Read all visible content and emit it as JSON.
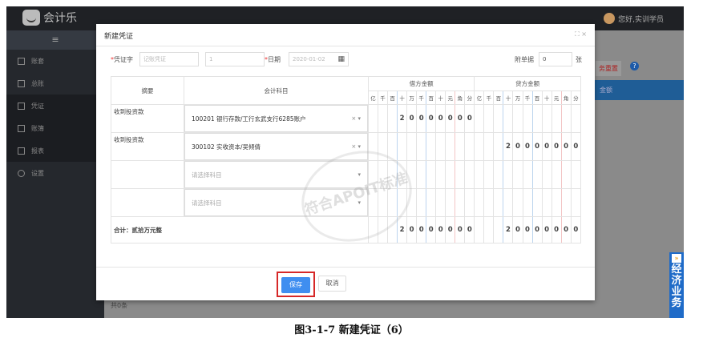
{
  "app": {
    "logo_text": "会计乐",
    "user": "您好,实训学员"
  },
  "sidebar": {
    "toggle": "≡",
    "items": [
      "账套",
      "总账",
      "凭证",
      "账簿",
      "报表",
      "设置"
    ]
  },
  "background": {
    "reset": "务重置",
    "help": "?",
    "bar": "金额",
    "footer": "共0条"
  },
  "float": {
    "arrow": "»",
    "label": "经济业务"
  },
  "modal": {
    "title": "新建凭证",
    "ctrl": "⛶ ×",
    "voucher_label": "凭证字",
    "voucher_word": "记账凭证",
    "voucher_no": "1",
    "date_label": "日期",
    "date": "2020-01-02",
    "cal": "▦",
    "attach_label": "附单据",
    "attach": "0",
    "attach_unit": "张",
    "table": {
      "h_summary": "摘要",
      "h_account": "会计科目",
      "h_debit": "借方金额",
      "h_credit": "贷方金额",
      "units": [
        "亿",
        "千",
        "百",
        "十",
        "万",
        "千",
        "百",
        "十",
        "元",
        "角",
        "分"
      ],
      "rows": [
        {
          "summary": "收到投资款",
          "account": "100201 银行存款/工行玄武支行6285账户",
          "debit": "20000000",
          "credit": ""
        },
        {
          "summary": "收到投资款",
          "account": "300102 实收资本/吴倾倩",
          "debit": "",
          "credit": "20000000"
        },
        {
          "summary": "",
          "account": "请选择科目",
          "debit": "",
          "credit": ""
        },
        {
          "summary": "",
          "account": "请选择科目",
          "debit": "",
          "credit": ""
        }
      ],
      "total_label": "合计：贰拾万元整",
      "total_debit": "20000000",
      "total_credit": "20000000"
    },
    "save": "保存",
    "cancel": "取消",
    "watermark": "符合APOIT标准"
  },
  "caption": "图3-1-7 新建凭证（6）"
}
